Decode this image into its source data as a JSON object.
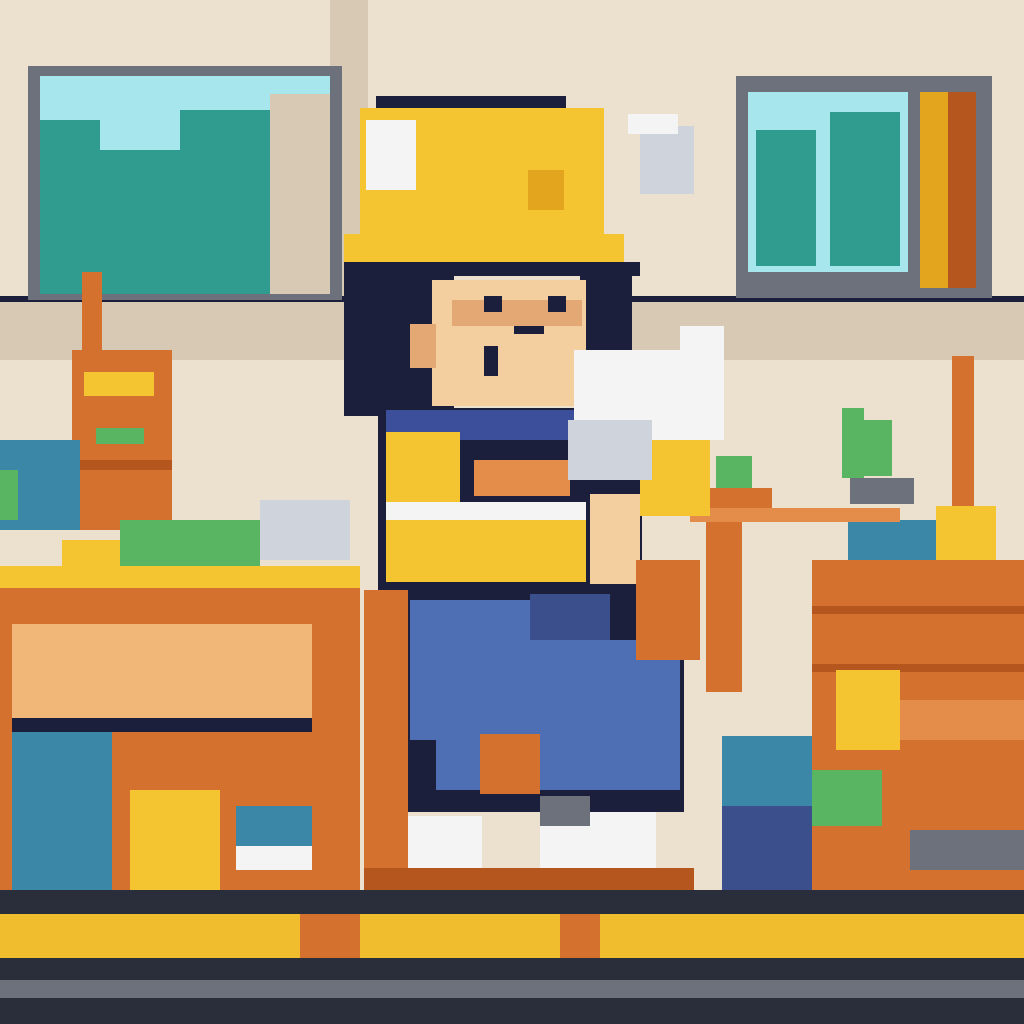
{
  "scene": {
    "palette": {
      "wall": "#ece1cf",
      "wall_shade": "#d8c9b4",
      "outline": "#1b1f3b",
      "helmet": "#f5c531",
      "helmet_shade": "#e2a51d",
      "skin": "#f3cf9f",
      "skin_shade": "#e3a873",
      "hair": "#1b1f3b",
      "vest": "#f5c531",
      "shirt": "#3c4f9a",
      "jeans": "#4f6fb5",
      "jeans_shade": "#3a4f8c",
      "white": "#f4f4f4",
      "white_shade": "#cfd3dc",
      "brick": "#d5712f",
      "brick_light": "#e48d4a",
      "brick_dark": "#b5561e",
      "wood": "#f0b778",
      "window_sky": "#a7e6ec",
      "window_leaf": "#2f9c8f",
      "green": "#5ab563",
      "teal": "#3b87a8",
      "gray": "#6d717c",
      "floor_yellow": "#f0bd2e",
      "floor_dark": "#2a2d3a"
    },
    "icons": [
      "construction-worker-sprite",
      "hard-hat-icon",
      "paper-roll-icon",
      "pixel-plant-icon"
    ]
  }
}
